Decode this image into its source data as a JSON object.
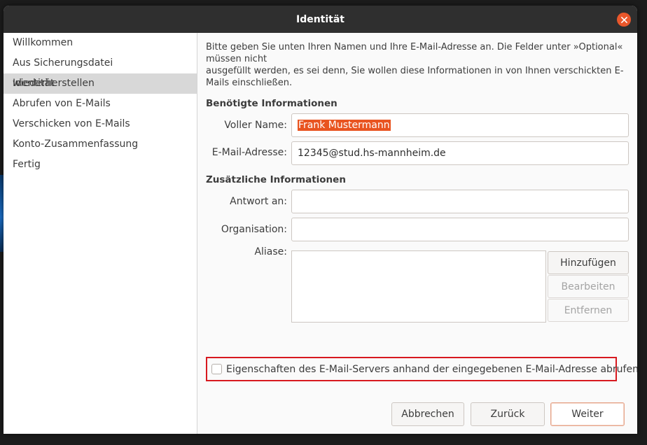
{
  "window": {
    "title": "Identität"
  },
  "sidebar": {
    "items": [
      {
        "label": "Willkommen",
        "active": false
      },
      {
        "label": "Aus Sicherungsdatei wiederherstellen",
        "active": false
      },
      {
        "label": "Identität",
        "active": true
      },
      {
        "label": "Abrufen von E-Mails",
        "active": false
      },
      {
        "label": "Verschicken von E-Mails",
        "active": false
      },
      {
        "label": "Konto-Zusammenfassung",
        "active": false
      },
      {
        "label": "Fertig",
        "active": false
      }
    ]
  },
  "intro": {
    "line1": "Bitte geben Sie unten Ihren Namen und Ihre E-Mail-Adresse an. Die Felder unter »Optional«",
    "line2": "müssen nicht",
    "line3": "ausgefüllt werden, es sei denn, Sie wollen diese Informationen in von Ihnen verschickten E-",
    "line4": "Mails einschließen."
  },
  "required": {
    "title": "Benötigte Informationen",
    "full_name_label": "Voller Name:",
    "full_name_value": "Frank Mustermann",
    "email_label": "E-Mail-Adresse:",
    "email_value": "12345@stud.hs-mannheim.de"
  },
  "optional": {
    "title": "Zusätzliche Informationen",
    "reply_to_label": "Antwort an:",
    "reply_to_value": "",
    "organization_label": "Organisation:",
    "organization_value": "",
    "aliases_label": "Aliase:"
  },
  "alias_buttons": {
    "add": "Hinzufügen",
    "edit": "Bearbeiten",
    "remove": "Entfernen"
  },
  "checkbox": {
    "label": "Eigenschaften des E-Mail-Servers anhand der eingegebenen E-Mail-Adresse abrufen",
    "checked": false
  },
  "footer": {
    "cancel": "Abbrechen",
    "back": "Zurück",
    "next": "Weiter"
  },
  "colors": {
    "accent": "#e95420",
    "highlight_border": "#d7191f",
    "titlebar": "#2f2f2f"
  }
}
